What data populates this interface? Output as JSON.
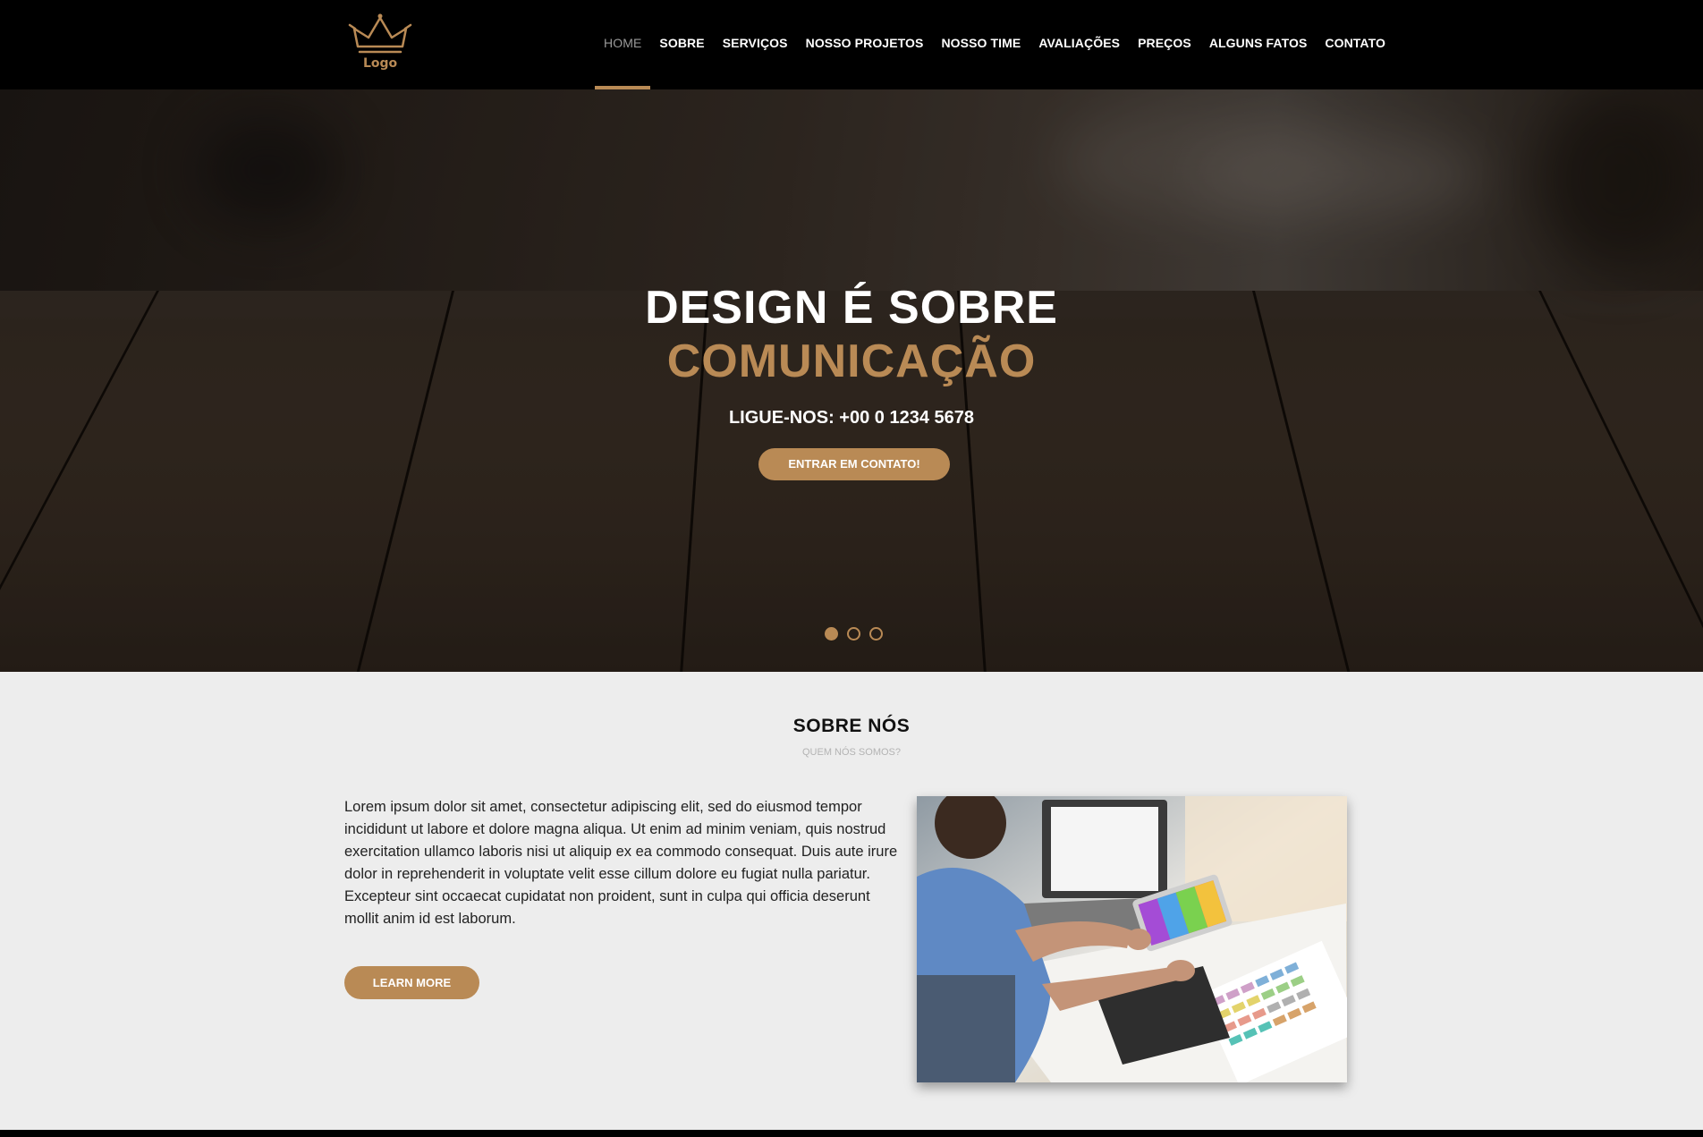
{
  "brand": {
    "logo_text": "Logo",
    "accent_color": "#b98a55"
  },
  "nav": {
    "items": [
      {
        "label": "HOME",
        "active": true
      },
      {
        "label": "SOBRE"
      },
      {
        "label": "SERVIÇOS"
      },
      {
        "label": "NOSSO PROJETOS"
      },
      {
        "label": "NOSSO TIME"
      },
      {
        "label": "AVALIAÇÕES"
      },
      {
        "label": "PREÇOS"
      },
      {
        "label": "ALGUNS FATOS"
      },
      {
        "label": "CONTATO"
      }
    ]
  },
  "hero": {
    "title_line1": "DESIGN É SOBRE",
    "title_line2": "COMUNICAÇÃO",
    "phone": "LIGUE-NOS: +00 0 1234 5678",
    "cta_label": "ENTRAR EM CONTATO!",
    "slides_count": 3,
    "active_slide": 1
  },
  "about": {
    "title": "SOBRE NÓS",
    "subtitle": "QUEM NÓS SOMOS?",
    "body": "Lorem ipsum dolor sit amet, consectetur adipiscing elit, sed do eiusmod tempor incididunt ut labore et dolore magna aliqua. Ut enim ad minim veniam, quis nostrud exercitation ullamco laboris nisi ut aliquip ex ea commodo consequat. Duis aute irure dolor in reprehenderit in voluptate velit esse cillum dolore eu fugiat nulla pariatur. Excepteur sint occaecat cupidatat non proident, sunt in culpa qui officia deserunt mollit anim id est laborum.",
    "button_label": "LEARN MORE"
  }
}
